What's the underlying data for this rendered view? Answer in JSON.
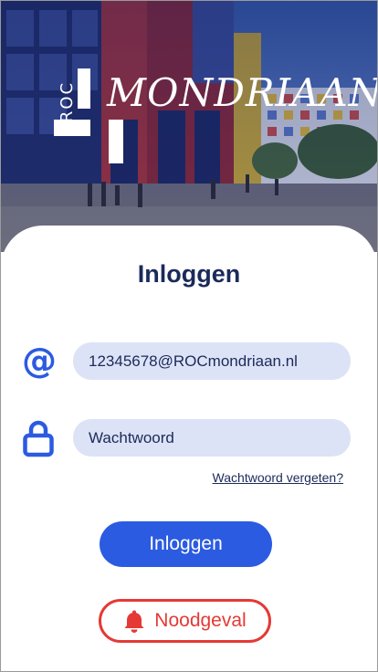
{
  "hero": {
    "logo_small_text": "ROC",
    "logo_text": "MONDRIAAN"
  },
  "login": {
    "title": "Inloggen",
    "email_value": "12345678@ROCmondriaan.nl",
    "email_icon": "@",
    "password_placeholder": "Wachtwoord",
    "forgot_password": "Wachtwoord vergeten?",
    "login_button": "Inloggen",
    "emergency_button": "Noodgeval"
  },
  "colors": {
    "primary": "#2b5be0",
    "title": "#1b2a5a",
    "input_background": "#dde3f6",
    "emergency": "#e53935"
  },
  "icons": [
    "at-icon",
    "lock-icon",
    "bell-icon"
  ]
}
